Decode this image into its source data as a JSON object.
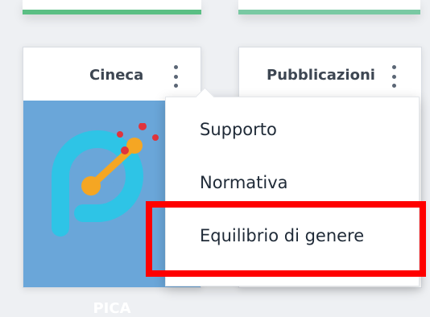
{
  "colors": {
    "top_bar_left": "#5bbf84",
    "top_bar_right": "#79c9a3",
    "tile_blue": "#6aa6d9",
    "highlight": "#ff0000",
    "logo_red": "#e0343c",
    "logo_orange": "#f5a623",
    "logo_cyan": "#2ec4e6"
  },
  "cards": [
    {
      "title": "Cineca",
      "app_label": "PICA",
      "logo_icon": "pica-logo-icon",
      "menu_icon": "kebab-menu-icon"
    },
    {
      "title": "Pubblicazioni",
      "menu_icon": "kebab-menu-icon"
    }
  ],
  "dropdown": {
    "items": [
      {
        "label": "Supporto"
      },
      {
        "label": "Normativa"
      },
      {
        "label": "Equilibrio di genere",
        "highlighted": true
      }
    ]
  }
}
